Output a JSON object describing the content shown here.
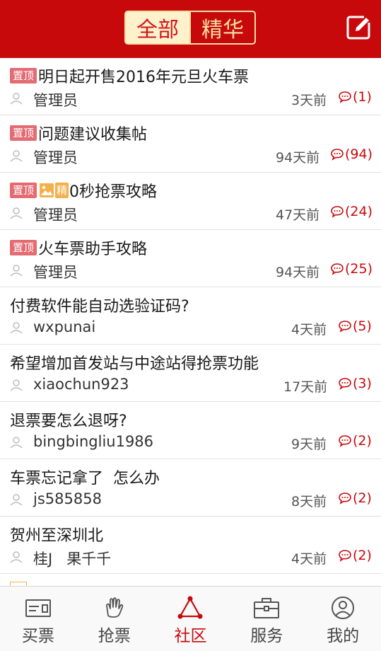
{
  "header": {
    "tabs": [
      {
        "label": "全部",
        "active": true
      },
      {
        "label": "精华",
        "active": false
      }
    ],
    "edit_icon": "compose-icon"
  },
  "colors": {
    "brand": "#c8090c",
    "tab_gold": "#f5e1a1",
    "pin_badge": "#e36b71",
    "essence_badge": "#f4b04c"
  },
  "posts": [
    {
      "title": "明日起开售2016年元旦火车票",
      "pinned_label": "置顶",
      "author": "管理员",
      "time": "3天前",
      "comments": "(1)"
    },
    {
      "title": "问题建议收集帖",
      "pinned_label": "置顶",
      "author": "管理员",
      "time": "94天前",
      "comments": "(94)"
    },
    {
      "title": "0秒抢票攻略",
      "pinned_label": "置顶",
      "essence_label": "精",
      "author": "管理员",
      "time": "47天前",
      "comments": "(24)"
    },
    {
      "title": "火车票助手攻略",
      "pinned_label": "置顶",
      "author": "管理员",
      "time": "94天前",
      "comments": "(25)"
    },
    {
      "title": "付费软件能自动选验证码?",
      "author": "wxpunai",
      "time": "4天前",
      "comments": "(5)"
    },
    {
      "title": "希望增加首发站与中途站得抢票功能",
      "author": "xiaochun923",
      "time": "17天前",
      "comments": "(3)"
    },
    {
      "title": "退票要怎么退呀?",
      "author": "bingbingliu1986",
      "time": "9天前",
      "comments": "(2)"
    },
    {
      "title": "车票忘记拿了  怎么办",
      "author": "js585858",
      "time": "8天前",
      "comments": "(2)"
    },
    {
      "title": "贺州至深圳北",
      "author": "桂J   果千千",
      "time": "4天前",
      "comments": "(2)"
    }
  ],
  "tabbar": [
    {
      "label": "买票",
      "icon": "ticket-icon",
      "active": false
    },
    {
      "label": "抢票",
      "icon": "grab-hand-icon",
      "active": false
    },
    {
      "label": "社区",
      "icon": "community-triangle-icon",
      "active": true
    },
    {
      "label": "服务",
      "icon": "briefcase-icon",
      "active": false
    },
    {
      "label": "我的",
      "icon": "profile-icon",
      "active": false
    }
  ]
}
